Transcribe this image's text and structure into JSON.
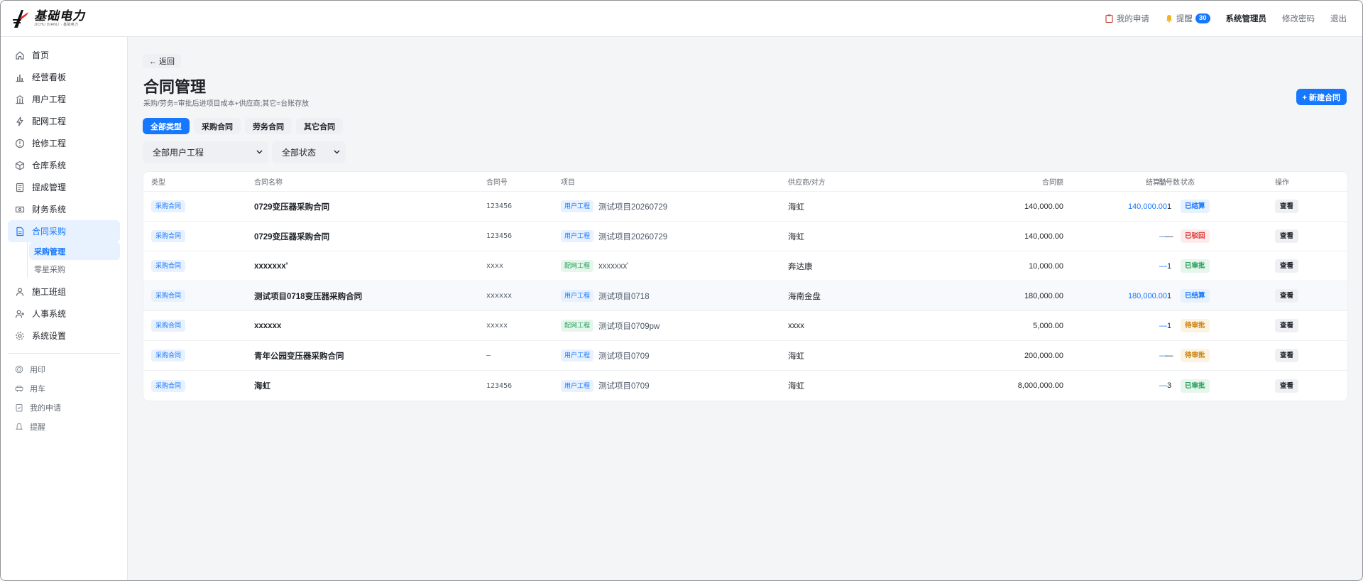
{
  "header": {
    "logo_title": "基础电力",
    "logo_sub": "JICHU DIANLI · 基础电力",
    "my_requests": "我的申请",
    "reminders": "提醒",
    "reminder_count": "30",
    "user": "系统管理员",
    "change_password": "修改密码",
    "logout": "退出"
  },
  "sidebar": {
    "items": [
      {
        "label": "首页",
        "icon": "home-icon"
      },
      {
        "label": "经营看板",
        "icon": "bar-chart-icon"
      },
      {
        "label": "用户工程",
        "icon": "building-icon"
      },
      {
        "label": "配网工程",
        "icon": "lightning-icon"
      },
      {
        "label": "抢修工程",
        "icon": "alert-icon"
      },
      {
        "label": "仓库系统",
        "icon": "box-icon"
      },
      {
        "label": "提成管理",
        "icon": "document-icon"
      },
      {
        "label": "财务系统",
        "icon": "money-icon"
      },
      {
        "label": "合同采购",
        "icon": "contract-icon"
      }
    ],
    "sub_items": [
      "采购管理",
      "零星采购"
    ],
    "items_after": [
      {
        "label": "施工班组",
        "icon": "team-icon"
      },
      {
        "label": "人事系统",
        "icon": "user-add-icon"
      },
      {
        "label": "系统设置",
        "icon": "gear-icon"
      }
    ],
    "secondary": [
      {
        "label": "用印",
        "icon": "seal-icon"
      },
      {
        "label": "用车",
        "icon": "car-icon"
      },
      {
        "label": "我的申请",
        "icon": "clipboard-icon"
      },
      {
        "label": "提醒",
        "icon": "bell-icon"
      }
    ]
  },
  "page": {
    "back": "← 返回",
    "title": "合同管理",
    "subtitle": "采购/劳务=审批后进项目成本+供应商;其它=台账存放",
    "new_button": "+ 新建合同",
    "tabs": [
      "全部类型",
      "采购合同",
      "劳务合同",
      "其它合同"
    ],
    "filter_project": "全部用户工程",
    "filter_status": "全部状态"
  },
  "table": {
    "headers": {
      "type": "类型",
      "name": "合同名称",
      "no": "合同号",
      "project": "项目",
      "supplier": "供应商/对方",
      "amount": "合同额",
      "settle": "结算价",
      "models": "型号数",
      "status": "状态",
      "op": "操作"
    },
    "rows": [
      {
        "type": "采购合同",
        "name": "0729变压器采购合同",
        "no": "123456",
        "proj_tag": "用户工程",
        "proj_color": "blue",
        "project": "测试项目20260729",
        "supplier": "海虹",
        "amount": "140,000.00",
        "settle": "140,000.00",
        "models": "1",
        "status": "已结算",
        "status_kind": "settled",
        "op": "查看"
      },
      {
        "type": "采购合同",
        "name": "0729变压器采购合同",
        "no": "123456",
        "proj_tag": "用户工程",
        "proj_color": "blue",
        "project": "测试项目20260729",
        "supplier": "海虹",
        "amount": "140,000.00",
        "settle": "—",
        "models": "—",
        "status": "已驳回",
        "status_kind": "rejected",
        "op": "查看"
      },
      {
        "type": "采购合同",
        "name": "xxxxxxx'",
        "no": "xxxx",
        "proj_tag": "配网工程",
        "proj_color": "green",
        "project": "xxxxxxx'",
        "supplier": "奔达康",
        "amount": "10,000.00",
        "settle": "—",
        "models": "1",
        "status": "已审批",
        "status_kind": "approved",
        "op": "查看"
      },
      {
        "type": "采购合同",
        "name": "测试项目0718变压器采购合同",
        "no": "xxxxxx",
        "proj_tag": "用户工程",
        "proj_color": "blue",
        "project": "测试项目0718",
        "supplier": "海南金盘",
        "amount": "180,000.00",
        "settle": "180,000.00",
        "models": "1",
        "status": "已结算",
        "status_kind": "settled",
        "op": "查看"
      },
      {
        "type": "采购合同",
        "name": "xxxxxx",
        "no": "xxxxx",
        "proj_tag": "配网工程",
        "proj_color": "green",
        "project": "测试项目0709pw",
        "supplier": "xxxx",
        "amount": "5,000.00",
        "settle": "—",
        "models": "1",
        "status": "待审批",
        "status_kind": "pending",
        "op": "查看"
      },
      {
        "type": "采购合同",
        "name": "青年公园变压器采购合同",
        "no": "—",
        "proj_tag": "用户工程",
        "proj_color": "blue",
        "project": "测试项目0709",
        "supplier": "海虹",
        "amount": "200,000.00",
        "settle": "—",
        "models": "—",
        "status": "待审批",
        "status_kind": "pending",
        "op": "查看"
      },
      {
        "type": "采购合同",
        "name": "海虹",
        "no": "123456",
        "proj_tag": "用户工程",
        "proj_color": "blue",
        "project": "测试项目0709",
        "supplier": "海虹",
        "amount": "8,000,000.00",
        "settle": "—",
        "models": "3",
        "status": "已审批",
        "status_kind": "approved",
        "op": "查看"
      }
    ]
  }
}
